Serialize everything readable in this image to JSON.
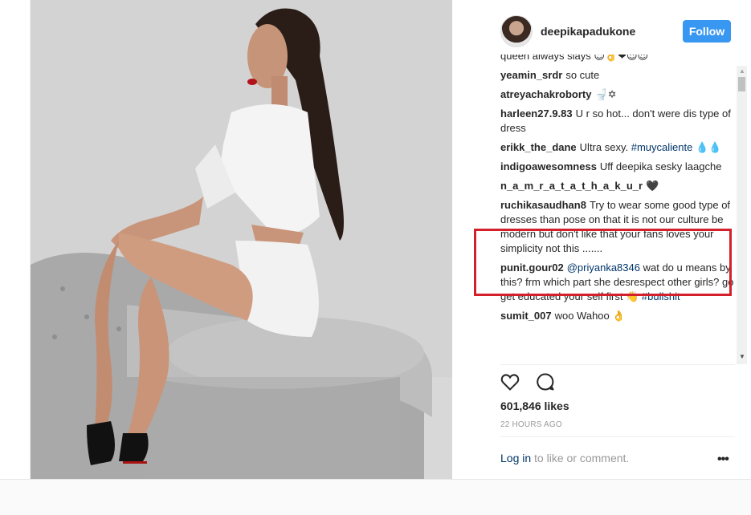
{
  "post": {
    "username": "deepikapadukone",
    "follow_label": "Follow",
    "likes": "601,846 likes",
    "time": "22 HOURS AGO",
    "login_link": "Log in",
    "login_rest": " to like or comment.",
    "more_label": "•••"
  },
  "comments": [
    {
      "user": "",
      "text": "queen always slays 😊👌❤😍😍"
    },
    {
      "user": "yeamin_srdr",
      "text": "so cute"
    },
    {
      "user": "atreyachakroborty",
      "text": "🚽✡"
    },
    {
      "user": "harleen27.9.83",
      "text": "U r so hot... don't were dis type of dress"
    },
    {
      "user": "erikk_the_dane",
      "text": "Ultra sexy. ",
      "tag": "#muycaliente",
      "tail": " 💧💧"
    },
    {
      "user": "indigoawesomness",
      "text": "Uff deepika sesky laagche"
    },
    {
      "user": "n_a_m_r_a_t_a_t_h_a_k_u_r",
      "text": "🖤"
    },
    {
      "user": "ruchikasaudhan8",
      "text": "Try to wear some good type of dresses than pose on that it is not our culture be modern but don't like that your fans loves your simplicity not this ......."
    },
    {
      "user": "punit.gour02",
      "tag": "@priyanka8346",
      "text": " wat do u means by this? frm which part she desrespect other girls? go get educated your self first 👋 ",
      "tag2": "#bullshit"
    },
    {
      "user": "sumit_007",
      "text": "woo Wahoo 👌"
    }
  ],
  "icons": {
    "heart": "heart-icon",
    "comment": "comment-icon"
  },
  "colors": {
    "follow_bg": "#3897f0",
    "highlight": "#d4202a",
    "link": "#003569"
  }
}
